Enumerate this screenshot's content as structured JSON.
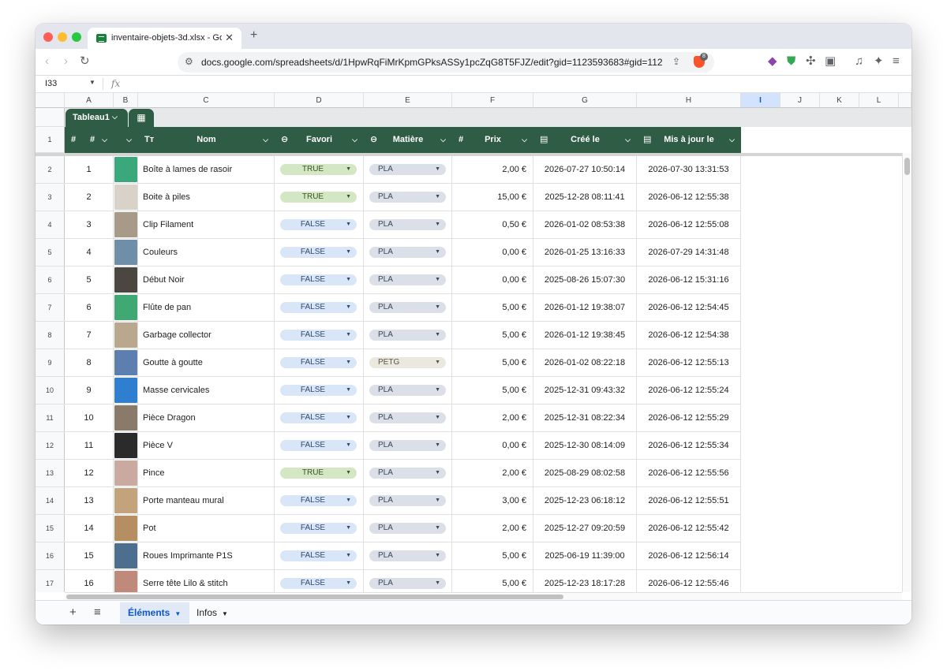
{
  "browser": {
    "tab_title": "inventaire-objets-3d.xlsx - Go",
    "url": "docs.google.com/spreadsheets/d/1HpwRqFiMrKpmGPksASSy1pcZqG8T5FJZ/edit?gid=1123593683#gid=112...",
    "brave_badge": "8"
  },
  "sheet": {
    "cell_ref": "I33",
    "fx": "fx",
    "columns": [
      "A",
      "B",
      "C",
      "D",
      "E",
      "F",
      "G",
      "H",
      "I",
      "J",
      "K",
      "L"
    ],
    "selected_column": "I",
    "table_name": "Tableau1",
    "headers": {
      "a_icon": "#",
      "a_label": "#",
      "c_icon": "Tт",
      "c_label": "Nom",
      "d_label": "Favori",
      "e_label": "Matière",
      "f_icon": "#",
      "f_label": "Prix",
      "g_label": "Créé le",
      "h_label": "Mis à jour le"
    }
  },
  "rows": [
    {
      "row": "2",
      "n": "1",
      "nom": "Boîte à lames de rasoir",
      "favori": "TRUE",
      "matiere": "PLA",
      "prix": "2,00 €",
      "cree": "2026-07-27 10:50:14",
      "maj": "2026-07-30 13:31:53",
      "thumb": "#3aa87a"
    },
    {
      "row": "3",
      "n": "2",
      "nom": "Boite à piles",
      "favori": "TRUE",
      "matiere": "PLA",
      "prix": "15,00 €",
      "cree": "2025-12-28 08:11:41",
      "maj": "2026-06-12 12:55:38",
      "thumb": "#d8d2c8"
    },
    {
      "row": "4",
      "n": "3",
      "nom": "Clip Filament",
      "favori": "FALSE",
      "matiere": "PLA",
      "prix": "0,50 €",
      "cree": "2026-01-02 08:53:38",
      "maj": "2026-06-12 12:55:08",
      "thumb": "#a89a88"
    },
    {
      "row": "5",
      "n": "4",
      "nom": "Couleurs",
      "favori": "FALSE",
      "matiere": "PLA",
      "prix": "0,00 €",
      "cree": "2026-01-25 13:16:33",
      "maj": "2026-07-29 14:31:48",
      "thumb": "#6f8fa8"
    },
    {
      "row": "6",
      "n": "5",
      "nom": "Début Noir",
      "favori": "FALSE",
      "matiere": "PLA",
      "prix": "0,00 €",
      "cree": "2025-08-26 15:07:30",
      "maj": "2026-06-12 15:31:16",
      "thumb": "#4b4640"
    },
    {
      "row": "7",
      "n": "6",
      "nom": "Flûte de pan",
      "favori": "FALSE",
      "matiere": "PLA",
      "prix": "5,00 €",
      "cree": "2026-01-12 19:38:07",
      "maj": "2026-06-12 12:54:45",
      "thumb": "#3fa873"
    },
    {
      "row": "8",
      "n": "7",
      "nom": "Garbage collector",
      "favori": "FALSE",
      "matiere": "PLA",
      "prix": "5,00 €",
      "cree": "2026-01-12 19:38:45",
      "maj": "2026-06-12 12:54:38",
      "thumb": "#b9a88e"
    },
    {
      "row": "9",
      "n": "8",
      "nom": "Goutte à goutte",
      "favori": "FALSE",
      "matiere": "PETG",
      "prix": "5,00 €",
      "cree": "2026-01-02 08:22:18",
      "maj": "2026-06-12 12:55:13",
      "thumb": "#5c7fb0"
    },
    {
      "row": "10",
      "n": "9",
      "nom": "Masse cervicales",
      "favori": "FALSE",
      "matiere": "PLA",
      "prix": "5,00 €",
      "cree": "2025-12-31 09:43:32",
      "maj": "2026-06-12 12:55:24",
      "thumb": "#2f7fd0"
    },
    {
      "row": "11",
      "n": "10",
      "nom": "Pièce Dragon",
      "favori": "FALSE",
      "matiere": "PLA",
      "prix": "2,00 €",
      "cree": "2025-12-31 08:22:34",
      "maj": "2026-06-12 12:55:29",
      "thumb": "#8a7a6a"
    },
    {
      "row": "12",
      "n": "11",
      "nom": "Pièce V",
      "favori": "FALSE",
      "matiere": "PLA",
      "prix": "0,00 €",
      "cree": "2025-12-30 08:14:09",
      "maj": "2026-06-12 12:55:34",
      "thumb": "#2b2b2b"
    },
    {
      "row": "13",
      "n": "12",
      "nom": "Pince",
      "favori": "TRUE",
      "matiere": "PLA",
      "prix": "2,00 €",
      "cree": "2025-08-29 08:02:58",
      "maj": "2026-06-12 12:55:56",
      "thumb": "#c9a9a0"
    },
    {
      "row": "14",
      "n": "13",
      "nom": "Porte manteau mural",
      "favori": "FALSE",
      "matiere": "PLA",
      "prix": "3,00 €",
      "cree": "2025-12-23 06:18:12",
      "maj": "2026-06-12 12:55:51",
      "thumb": "#c2a37c"
    },
    {
      "row": "15",
      "n": "14",
      "nom": "Pot",
      "favori": "FALSE",
      "matiere": "PLA",
      "prix": "2,00 €",
      "cree": "2025-12-27 09:20:59",
      "maj": "2026-06-12 12:55:42",
      "thumb": "#b58e62"
    },
    {
      "row": "16",
      "n": "15",
      "nom": "Roues Imprimante P1S",
      "favori": "FALSE",
      "matiere": "PLA",
      "prix": "5,00 €",
      "cree": "2025-06-19 11:39:00",
      "maj": "2026-06-12 12:56:14",
      "thumb": "#4d6f8f"
    },
    {
      "row": "17",
      "n": "16",
      "nom": "Serre tête Lilo & stitch",
      "favori": "FALSE",
      "matiere": "PLA",
      "prix": "5,00 €",
      "cree": "2025-12-23 18:17:28",
      "maj": "2026-06-12 12:55:46",
      "thumb": "#c08a7a"
    }
  ],
  "sheet_tabs": [
    {
      "label": "Éléments",
      "active": true
    },
    {
      "label": "Infos",
      "active": false
    }
  ]
}
